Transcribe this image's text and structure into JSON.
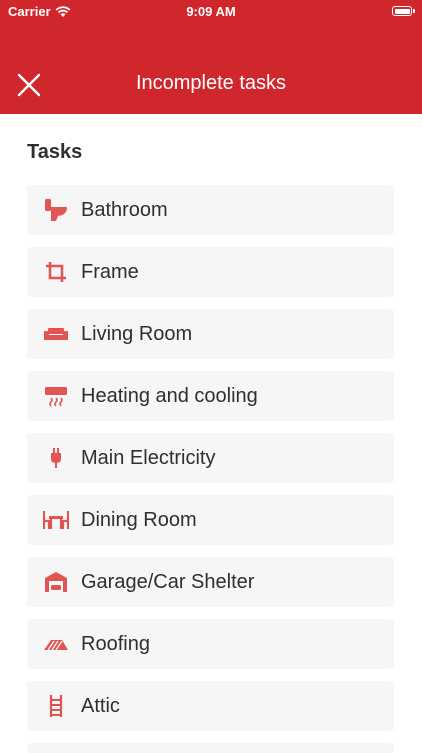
{
  "status_bar": {
    "carrier": "Carrier",
    "time": "9:09 AM"
  },
  "header": {
    "title": "Incomplete tasks"
  },
  "section": {
    "title": "Tasks"
  },
  "colors": {
    "accent": "#d0272c",
    "item_bg": "#f6f6f7",
    "icon": "#e25555"
  },
  "tasks": [
    {
      "label": "Bathroom",
      "icon": "toilet-icon"
    },
    {
      "label": "Frame",
      "icon": "crop-icon"
    },
    {
      "label": "Living Room",
      "icon": "sofa-icon"
    },
    {
      "label": "Heating and cooling",
      "icon": "air-conditioner-icon"
    },
    {
      "label": "Main Electricity",
      "icon": "plug-icon"
    },
    {
      "label": "Dining Room",
      "icon": "dining-table-icon"
    },
    {
      "label": "Garage/Car Shelter",
      "icon": "garage-icon"
    },
    {
      "label": "Roofing",
      "icon": "roof-icon"
    },
    {
      "label": "Attic",
      "icon": "ladder-icon"
    }
  ]
}
